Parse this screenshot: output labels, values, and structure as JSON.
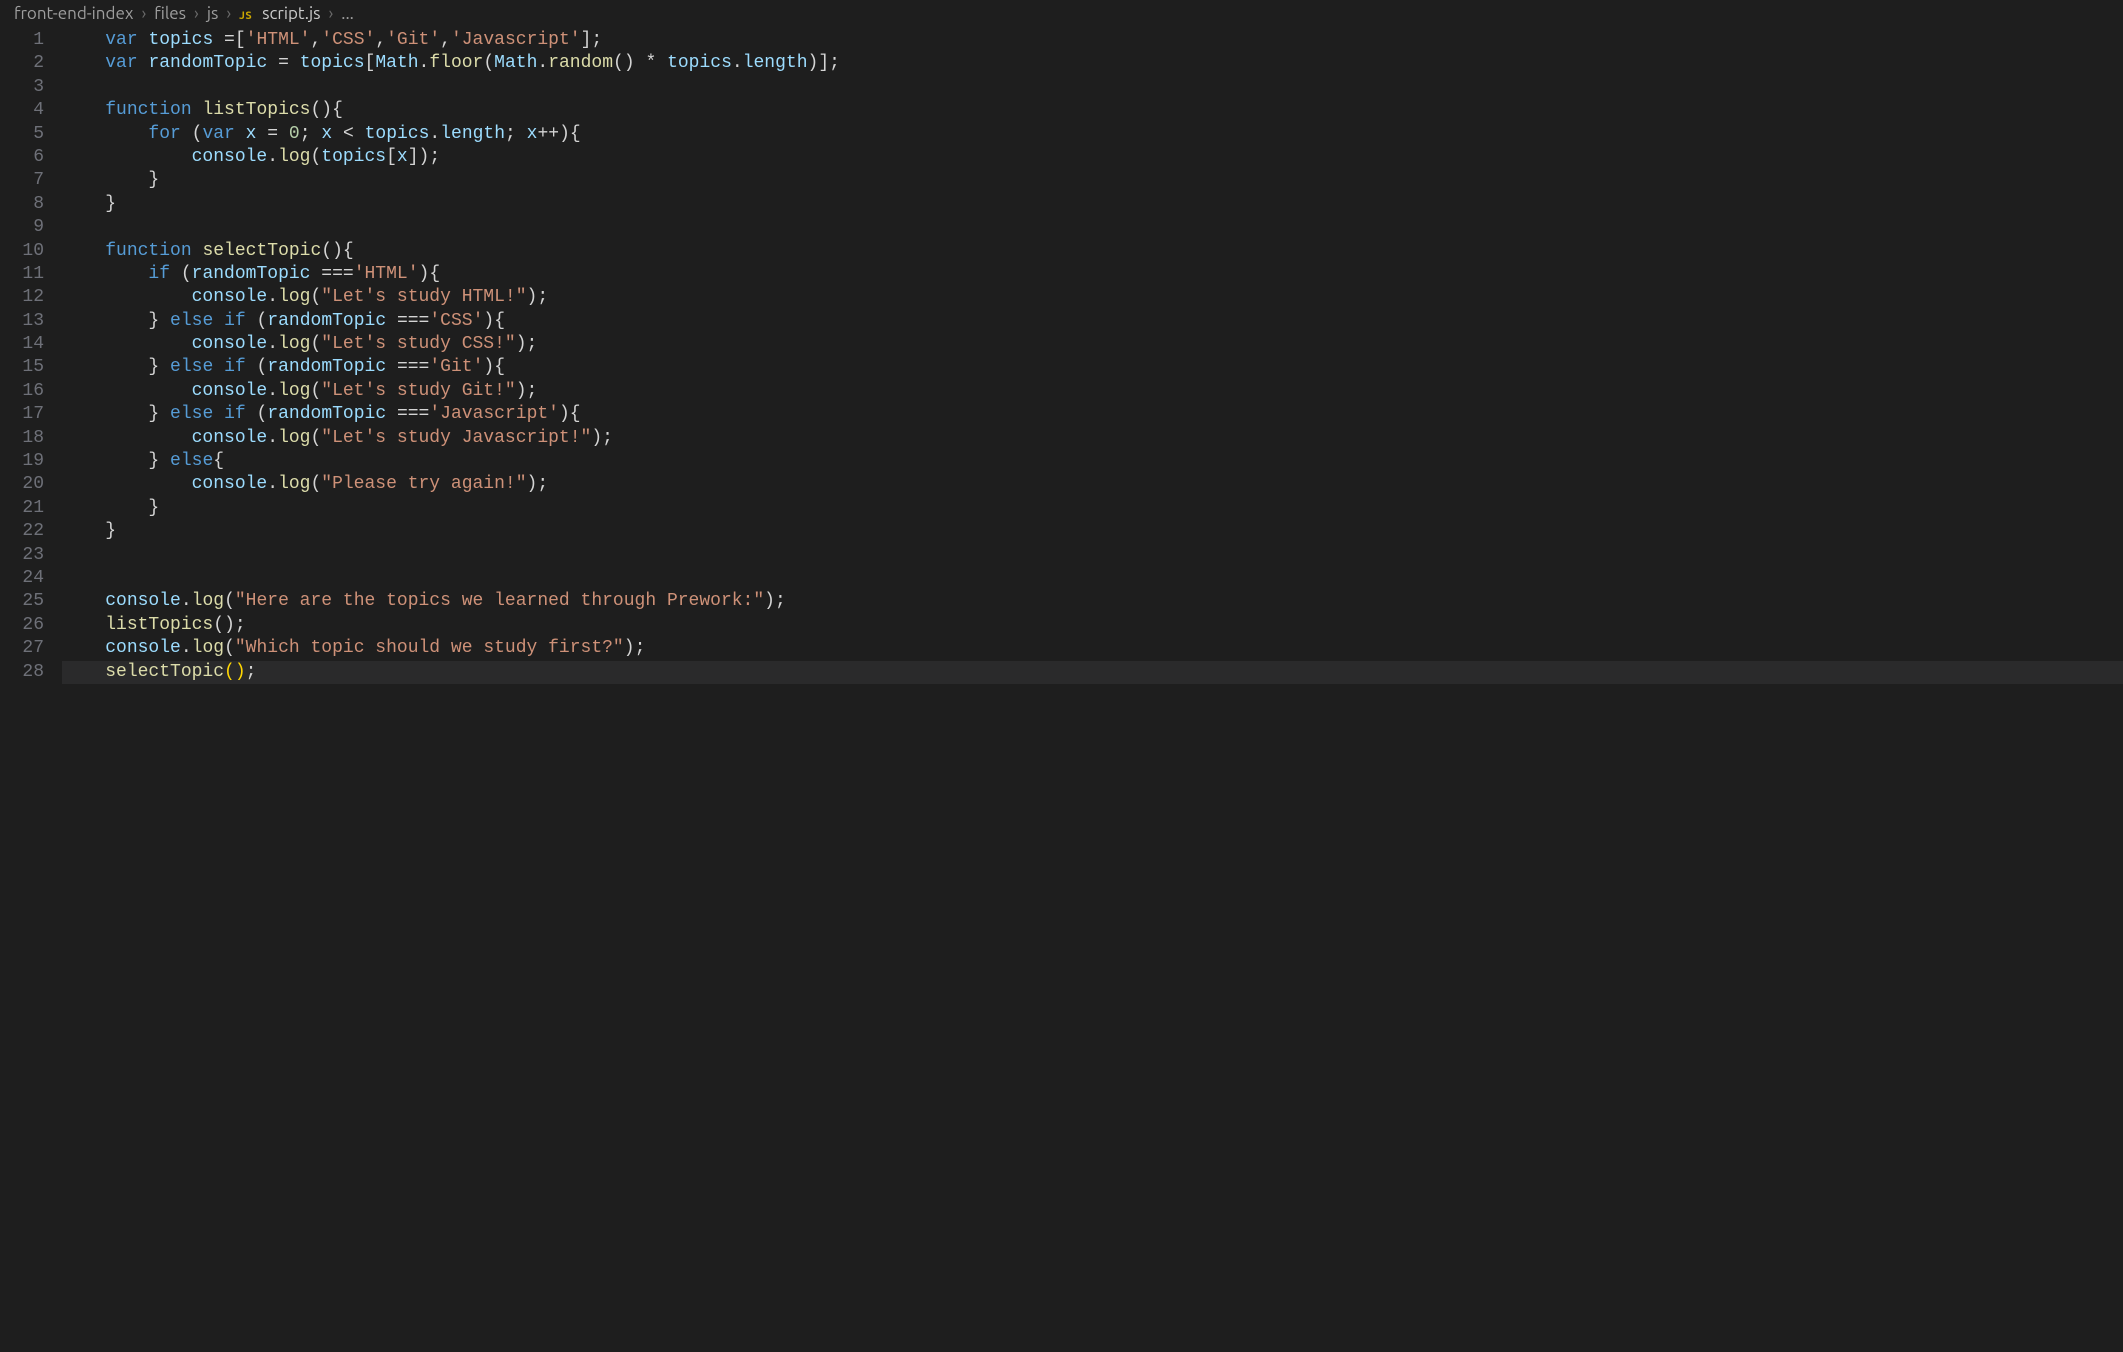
{
  "breadcrumbs": {
    "seg0": "front-end-index",
    "seg1": "files",
    "seg2": "js",
    "badge": "JS",
    "file": "script.js",
    "tail": "...",
    "sep": "›"
  },
  "line_numbers": [
    "1",
    "2",
    "3",
    "4",
    "5",
    "6",
    "7",
    "8",
    "9",
    "10",
    "11",
    "12",
    "13",
    "14",
    "15",
    "16",
    "17",
    "18",
    "19",
    "20",
    "21",
    "22",
    "23",
    "24",
    "25",
    "26",
    "27",
    "28"
  ],
  "current_line_index": 27,
  "code": {
    "kw_var": "var",
    "kw_function": "function",
    "kw_for": "for",
    "kw_if": "if",
    "kw_else": "else",
    "id_topics": "topics",
    "id_randomTopic": "randomTopic",
    "id_x": "x",
    "id_Math": "Math",
    "id_console": "console",
    "m_floor": "floor",
    "m_random": "random",
    "m_length": "length",
    "m_log": "log",
    "fn_listTopics": "listTopics",
    "fn_selectTopic": "selectTopic",
    "s_HTML": "'HTML'",
    "s_CSS": "'CSS'",
    "s_Git": "'Git'",
    "s_Javascript": "'Javascript'",
    "s_studyHTML": "\"Let's study HTML!\"",
    "s_studyCSS": "\"Let's study CSS!\"",
    "s_studyGit": "\"Let's study Git!\"",
    "s_studyJS": "\"Let's study Javascript!\"",
    "s_tryAgain": "\"Please try again!\"",
    "s_hereAre": "\"Here are the topics we learned through Prework:\"",
    "s_which": "\"Which topic should we study first?\"",
    "n_zero": "0",
    "op_assign": " =",
    "op_eqeqeq": "===",
    "op_lt": "<",
    "op_inc": "++",
    "op_star": "*",
    "p_ob": "[",
    "p_cb": "]",
    "p_op": "(",
    "p_cp": ")",
    "p_oc": "{",
    "p_cc": "}",
    "p_semi": ";",
    "p_comma": ",",
    "p_dot": "."
  }
}
